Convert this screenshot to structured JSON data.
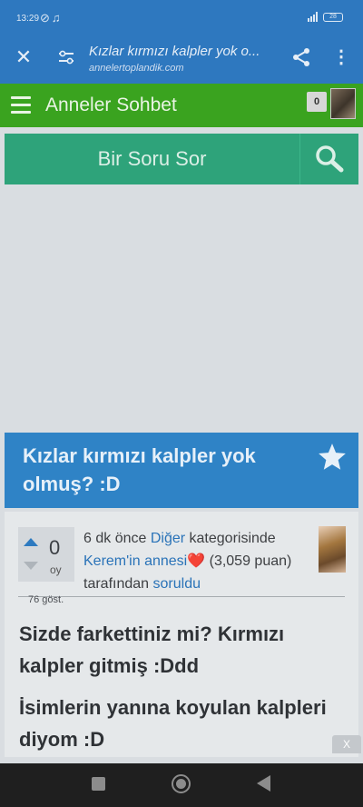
{
  "status_bar": {
    "time": "13:29",
    "battery": "28"
  },
  "browser": {
    "page_title": "Kızlar kırmızı kalpler yok o...",
    "url": "annelertoplandik.com"
  },
  "site": {
    "name": "Anneler Sohbet",
    "notification_count": "0",
    "ask_label": "Bir Soru Sor",
    "brand_green": "#3aa31f",
    "accent_blue": "#2f83c6"
  },
  "question": {
    "title": "Kızlar kırmızı kalpler yok olmuş? :D",
    "votes": "0",
    "votes_unit": "oy",
    "time_ago": "6 dk önce",
    "category": "Diğer",
    "category_suffix": "kategorisinde",
    "author": "Kerem'in annesi",
    "heart": "❤️",
    "points": "(3,059 puan)",
    "by_text": "tarafından",
    "action": "soruldu",
    "views": "76 göst.",
    "body_lines": [
      "Sizde farkettiniz mi? Kırmızı kalpler gitmiş :Ddd",
      "İsimlerin yanına koyulan kalpleri diyom :D"
    ]
  },
  "ad": {
    "close_label": "X"
  }
}
